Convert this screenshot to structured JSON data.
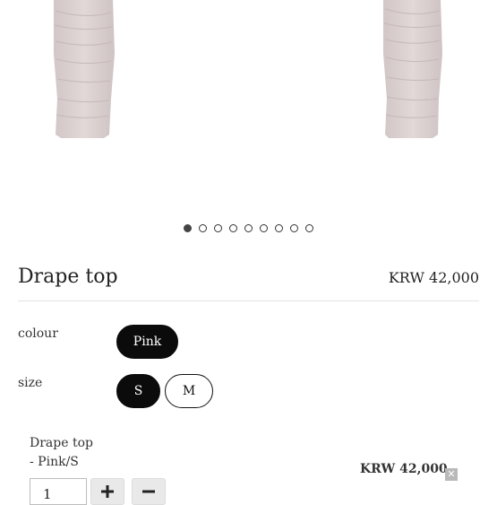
{
  "gallery": {
    "dots_total": 9,
    "active_index": 0
  },
  "product": {
    "name": "Drape top",
    "price": "KRW 42,000"
  },
  "options": {
    "colour": {
      "label": "colour",
      "values": [
        "Pink"
      ],
      "selected": "Pink"
    },
    "size": {
      "label": "size",
      "values": [
        "S",
        "M"
      ],
      "selected": "S"
    }
  },
  "selection": {
    "name": "Drape top",
    "variant": "- Pink/S",
    "quantity": "1",
    "price": "KRW 42,000",
    "remove_icon": "close-icon",
    "increase_icon": "plus-icon",
    "decrease_icon": "minus-icon"
  },
  "colors": {
    "accent": "#0b0b0b",
    "garment": "#d9cece"
  }
}
